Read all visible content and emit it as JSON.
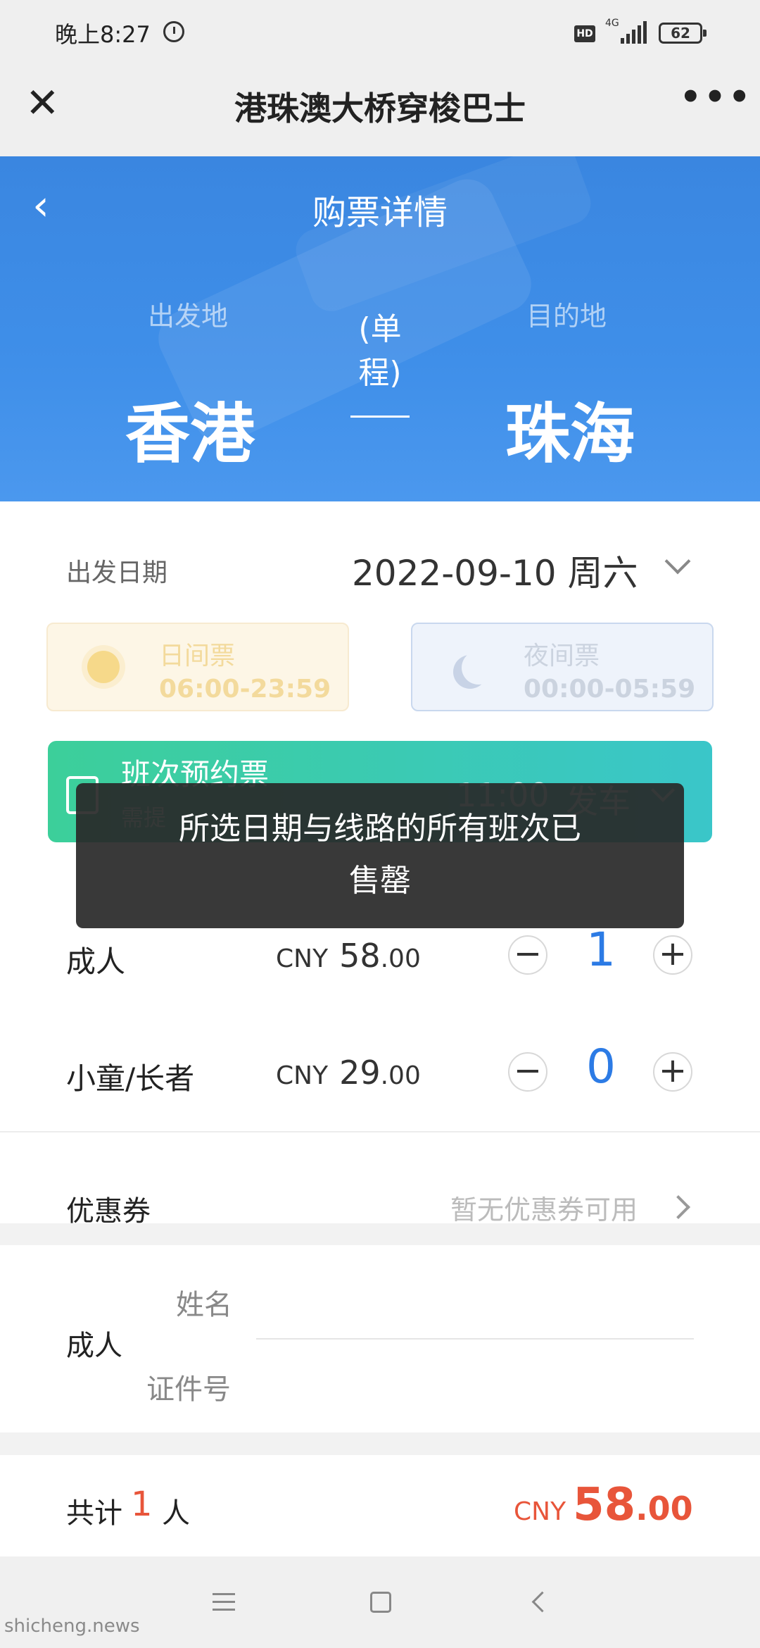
{
  "status_bar": {
    "time": "晚上8:27",
    "hd": "HD",
    "network": "4G",
    "battery": "62"
  },
  "title_bar": {
    "close_glyph": "✕",
    "title": "港珠澳大桥穿梭巴士",
    "more_glyph": "•••"
  },
  "hero": {
    "back_glyph": "‹",
    "page_title": "购票详情",
    "origin_label": "出发地",
    "origin_city": "香港",
    "trip_type": "(单程)",
    "destination_label": "目的地",
    "destination_city": "珠海"
  },
  "date": {
    "label": "出发日期",
    "value": "2022-09-10 周六"
  },
  "periods": {
    "day": {
      "name": "日间票",
      "hours": "06:00-23:59"
    },
    "night": {
      "name": "夜间票",
      "hours": "00:00-05:59"
    }
  },
  "schedule": {
    "label": "班次预约票",
    "sub": "需提",
    "time": "11:00",
    "depart": "发车"
  },
  "tickets": [
    {
      "label": "成人",
      "currency": "CNY",
      "price_int": "58",
      "price_dec": ".00",
      "qty": "1"
    },
    {
      "label": "小童/长者",
      "currency": "CNY",
      "price_int": "29",
      "price_dec": ".00",
      "qty": "0"
    }
  ],
  "stepper": {
    "minus": "−",
    "plus": "+"
  },
  "coupon": {
    "label": "优惠券",
    "value": "暂无优惠券可用"
  },
  "passenger": {
    "type": "成人",
    "name_label": "姓名",
    "id_label": "证件号"
  },
  "total": {
    "label": "共计",
    "count": "1",
    "unit": "人",
    "currency": "CNY",
    "amount_int": "58",
    "amount_dec": ".00"
  },
  "toast": {
    "line1": "所选日期与线路的所有班次已",
    "line2": "售罄"
  },
  "watermark": "shicheng.news",
  "colors": {
    "hero_blue": "#3f8fe9",
    "accent_blue": "#2c7be5",
    "price_red": "#e8553a",
    "schedule_green": "#3ccf9a"
  }
}
